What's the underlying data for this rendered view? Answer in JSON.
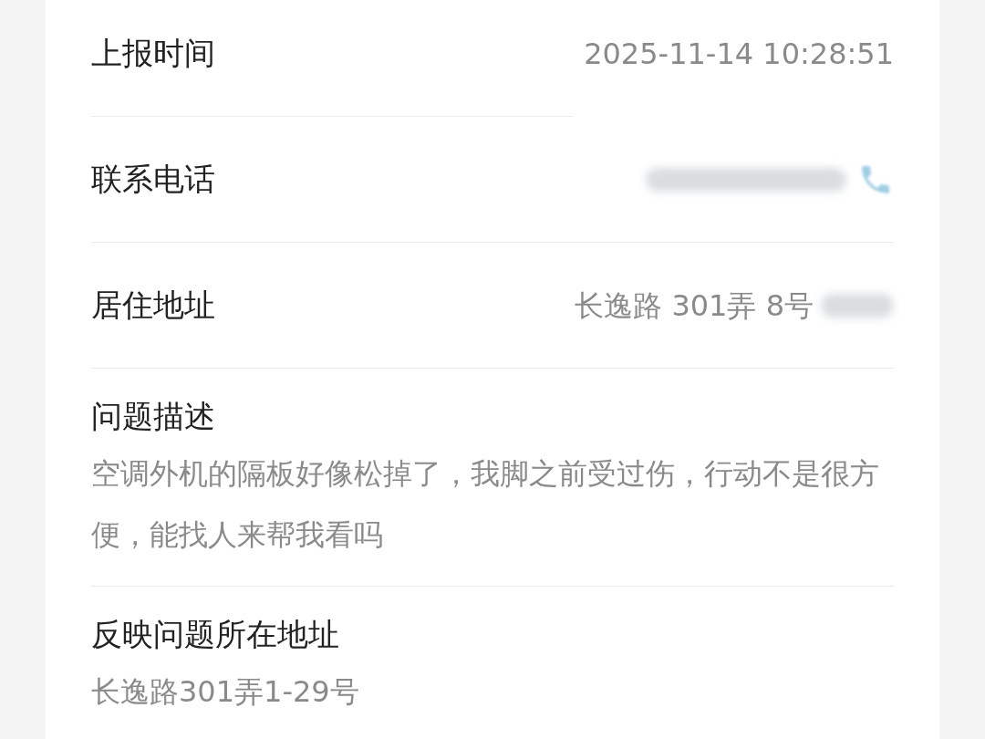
{
  "rows": [
    {
      "kind": "inline",
      "label": "上报时间",
      "value": "2025-11-14 10:28:51"
    },
    {
      "kind": "phone",
      "label": "联系电话"
    },
    {
      "kind": "address",
      "label": "居住地址",
      "value": "长逸路 301弄 8号"
    },
    {
      "kind": "block",
      "label": "问题描述",
      "value": "空调外机的隔板好像松掉了，我脚之前受过伤，行动不是很方便，能找人来帮我看吗"
    },
    {
      "kind": "block",
      "label": "反映问题所在地址",
      "value": "长逸路301弄1-29号"
    }
  ]
}
